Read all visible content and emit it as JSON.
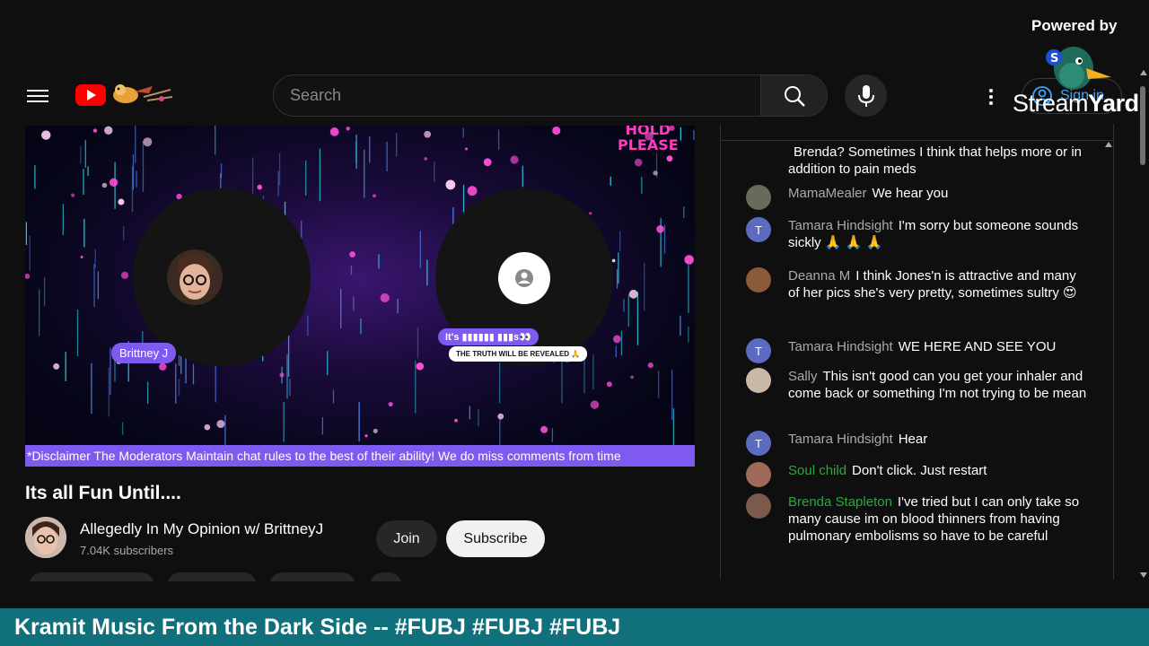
{
  "header": {
    "search_placeholder": "Search",
    "signin_label": "Sign in"
  },
  "overlay": {
    "powered_by": "Powered by",
    "brand_stream": "Stream",
    "brand_yard": "Yard"
  },
  "video": {
    "hold_line1": "HOLD",
    "hold_line2": "PLEASE",
    "participant_name": "Brittney J",
    "overlay_pill": "It's ▮▮▮▮▮▮ ▮▮▮s👀",
    "overlay_truth": "THE TRUTH WILL BE REVEALED 🙏",
    "ticker": "*Disclaimer The Moderators Maintain chat rules to the best of their ability! We do miss comments from time"
  },
  "info": {
    "title": "Its all Fun Until....",
    "channel_name": "Allegedly In My Opinion w/ BrittneyJ",
    "subscribers": "7.04K subscribers",
    "join_label": "Join",
    "subscribe_label": "Subscribe"
  },
  "chat": {
    "messages": [
      {
        "author": "",
        "text": "Brenda? Sometimes I think that helps more or in addition to pain meds",
        "avatar": ""
      },
      {
        "author": "MamaMealer",
        "text": "We hear you",
        "avatar": ""
      },
      {
        "author": "Tamara Hindsight",
        "text": "I'm sorry but someone sounds sickly 🙏 🙏 🙏",
        "avatar": "T"
      },
      {
        "author": "Deanna M",
        "text": "I think Jones'n is attractive and many of her pics she's very pretty, sometimes sultry 😍",
        "avatar": ""
      },
      {
        "author": "Tamara Hindsight",
        "text": "WE HERE AND SEE YOU",
        "avatar": "T"
      },
      {
        "author": "Sally",
        "text": "This isn't good can you get your inhaler and come back or something I'm not trying to be mean",
        "avatar": ""
      },
      {
        "author": "Tamara Hindsight",
        "text": "Hear",
        "avatar": "T"
      },
      {
        "author": "Soul child",
        "text": "Don't click. Just restart",
        "avatar": ""
      },
      {
        "author": "Brenda Stapleton",
        "text": "I've tried but I can only take so many cause im on blood thinners from having pulmonary embolisms so have to be careful",
        "avatar": ""
      }
    ]
  },
  "banner": {
    "text": "Kramit Music From the Dark Side -- #FUBJ #FUBJ #FUBJ"
  },
  "colors": {
    "accent_purple": "#7f5af0",
    "banner_teal": "#10707c",
    "youtube_red": "#ff0000",
    "member_green": "#2ba640"
  }
}
